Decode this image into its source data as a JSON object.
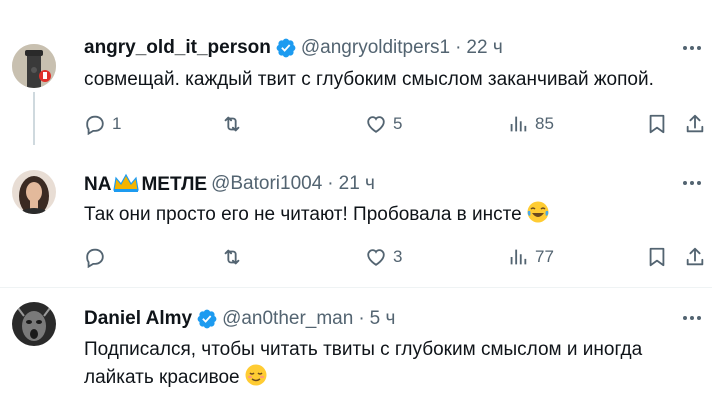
{
  "tweets": [
    {
      "author": "angry_old_it_person",
      "verified": true,
      "handle": "@angryolditpers1",
      "time": "22 ч",
      "text": "совмещай. каждый твит с глубоким смыслом заканчивай жопой.",
      "replies": "1",
      "retweets": "",
      "likes": "5",
      "views": "85"
    },
    {
      "author_prefix": "NA",
      "author_suffix": "МЕТЛЕ",
      "handle": "@Batori1004",
      "time": "21 ч",
      "text": "Так они просто его не читают! Пробовала в инсте",
      "emoji": "tears-of-joy",
      "replies": "",
      "retweets": "",
      "likes": "3",
      "views": "77"
    },
    {
      "author": "Daniel Almy",
      "verified": true,
      "handle": "@an0ther_man",
      "time": "5 ч",
      "text_line1": "Подписался, чтобы читать твиты с глубоким смыслом и иногда",
      "text_line2": "лайкать красивое",
      "emoji": "relieved-face"
    }
  ],
  "colors": {
    "text": "#0f1419",
    "secondary": "#536471",
    "verified": "#1d9bf0",
    "divider": "#eff3f4",
    "thread_line": "#cfd9de"
  }
}
